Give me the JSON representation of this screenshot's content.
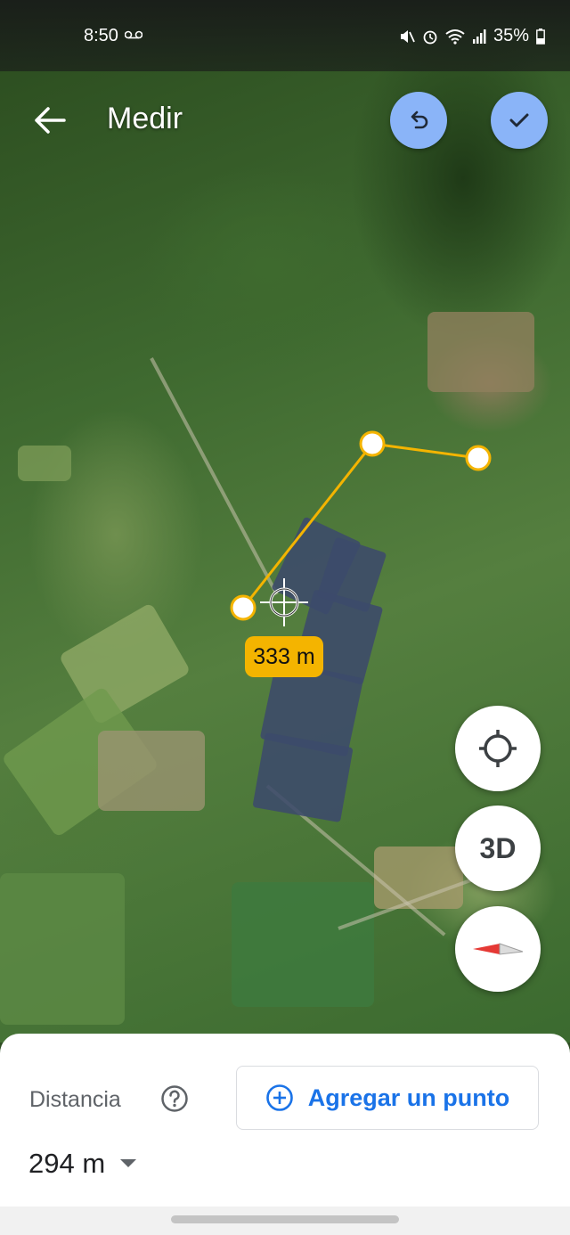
{
  "status_bar": {
    "time": "8:50",
    "battery": "35%",
    "icons": [
      "voicemail-icon",
      "mute-icon",
      "alarm-icon",
      "wifi-icon",
      "signal-icon",
      "battery-icon"
    ]
  },
  "header": {
    "title": "Medir",
    "back_icon": "arrow-back-icon",
    "undo_icon": "undo-icon",
    "done_icon": "check-icon"
  },
  "map": {
    "segment_label": "333 m",
    "line_color": "#f4b400",
    "crosshair_icon": "crosshair-icon"
  },
  "controls": {
    "my_location_icon": "my-location-icon",
    "three_d_label": "3D",
    "compass_icon": "compass-icon"
  },
  "bottom_sheet": {
    "distance_label": "Distancia",
    "help_icon": "help-icon",
    "add_point_label": "Agregar un punto",
    "add_point_icon": "plus-circle-icon",
    "distance_value": "294 m",
    "accent_color": "#1a73e8"
  }
}
